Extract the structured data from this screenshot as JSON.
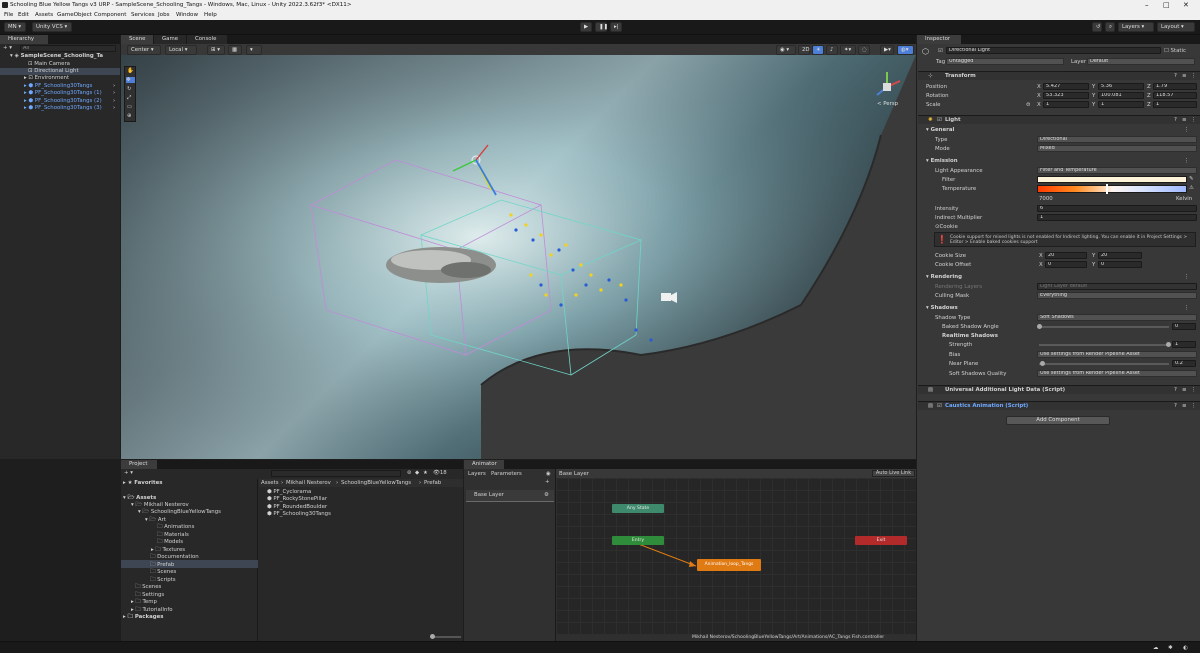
{
  "window": {
    "title": "Schooling Blue Yellow Tangs v3 URP - SampleScene_Schooling_Tangs - Windows, Mac, Linux - Unity 2022.3.62f3* <DX11>",
    "controls": [
      "–",
      "□",
      "✕"
    ]
  },
  "menu": [
    "File",
    "Edit",
    "Assets",
    "GameObject",
    "Component",
    "Services",
    "Jobs",
    "Window",
    "Help"
  ],
  "toolbar": {
    "account": "MN",
    "vcs": "Unity VCS",
    "layers": "Layers",
    "layout": "Layout"
  },
  "hierarchy": {
    "tab": "Hierarchy",
    "search_placeholder": "All",
    "scene": "SampleScene_Schooling_Ta",
    "items": [
      {
        "label": "Main Camera",
        "prefab": false
      },
      {
        "label": "Directional Light",
        "prefab": false,
        "selected": true
      },
      {
        "label": "Environment",
        "prefab": false
      },
      {
        "label": "PF_Schooling30Tangs",
        "prefab": true
      },
      {
        "label": "PF_Schooling30Tangs (1)",
        "prefab": true
      },
      {
        "label": "PF_Schooling30Tangs (2)",
        "prefab": true
      },
      {
        "label": "PF_Schooling30Tangs (3)",
        "prefab": true
      }
    ]
  },
  "scene_view": {
    "tabs": [
      "Scene",
      "Game",
      "Console"
    ],
    "pivot": "Center",
    "space": "Local",
    "mode_2d": "2D",
    "persp": "< Persp"
  },
  "project": {
    "tab": "Project",
    "favorites": "Favorites",
    "tree": [
      {
        "label": "Assets",
        "depth": 0,
        "bold": true
      },
      {
        "label": "Mikhail Nesterov",
        "depth": 1
      },
      {
        "label": "SchoolingBlueYellowTangs",
        "depth": 2
      },
      {
        "label": "Art",
        "depth": 3
      },
      {
        "label": "Animations",
        "depth": 4
      },
      {
        "label": "Materials",
        "depth": 4
      },
      {
        "label": "Models",
        "depth": 4
      },
      {
        "label": "Textures",
        "depth": 4
      },
      {
        "label": "Documentation",
        "depth": 3
      },
      {
        "label": "Prefab",
        "depth": 3,
        "selected": true
      },
      {
        "label": "Scenes",
        "depth": 3
      },
      {
        "label": "Scripts",
        "depth": 3
      },
      {
        "label": "Scenes",
        "depth": 1
      },
      {
        "label": "Settings",
        "depth": 1
      },
      {
        "label": "Temp",
        "depth": 1
      },
      {
        "label": "TutorialInfo",
        "depth": 1
      },
      {
        "label": "Packages",
        "depth": 0,
        "bold": true
      }
    ],
    "breadcrumb": [
      "Assets",
      "Mikhail Nesterov",
      "SchoolingBlueYellowTangs",
      "Prefab"
    ],
    "files": [
      "PF_Cyclorama",
      "PF_RockyStonePillar",
      "PF_RoundedBoulder",
      "PF_Schooling30Tangs"
    ],
    "count": "18"
  },
  "animator": {
    "tab": "Animator",
    "layers_tab": "Layers",
    "params_tab": "Parameters",
    "layer_crumb": "Base Layer",
    "auto_live": "Auto Live Link",
    "base_layer": "Base Layer",
    "states": {
      "any": "Any State",
      "entry": "Entry",
      "exit": "Exit",
      "anim": "Animation_loop_Tangs"
    },
    "path": "Mikhail Nesterov/SchoolingBlueYellowTangs/Art/Animations/AC_Tangs Fish.controller"
  },
  "inspector": {
    "tab": "Inspector",
    "object_name": "Directional Light",
    "static": "Static",
    "tag_label": "Tag",
    "tag": "Untagged",
    "layer_label": "Layer",
    "layer": "Default",
    "transform": {
      "title": "Transform",
      "rows": [
        {
          "label": "Position",
          "x": "5.427",
          "y": "5.36",
          "z": "1.79"
        },
        {
          "label": "Rotation",
          "x": "53.323",
          "y": "100.081",
          "z": "118.57"
        },
        {
          "label": "Scale",
          "x": "1",
          "y": "1",
          "z": "1"
        }
      ]
    },
    "light": {
      "title": "Light",
      "general": "General",
      "type_label": "Type",
      "type": "Directional",
      "mode_label": "Mode",
      "mode": "Mixed",
      "emission": "Emission",
      "appearance_label": "Light Appearance",
      "appearance": "Filter and Temperature",
      "filter_label": "Filter",
      "temperature_label": "Temperature",
      "temperature_value": "7000",
      "kelvin": "Kelvin",
      "intensity_label": "Intensity",
      "intensity": "6",
      "indirect_label": "Indirect Multiplier",
      "indirect": "1",
      "cookie_label": "Cookie",
      "cookie_note": "Cookie support for mixed lights is not enabled for Indirect lighting. You can enable it in Project Settings > Editor > Enable baked cookies support",
      "cookie_size_label": "Cookie Size",
      "cookie_size_x": "20",
      "cookie_size_y": "20",
      "cookie_offset_label": "Cookie Offset",
      "cookie_offset_x": "0",
      "cookie_offset_y": "0",
      "rendering": "Rendering",
      "rendering_layers_label": "Rendering Layers",
      "rendering_layers": "Light Layer default",
      "culling_label": "Culling Mask",
      "culling": "Everything",
      "shadows": "Shadows",
      "shadow_type_label": "Shadow Type",
      "shadow_type": "Soft Shadows",
      "baked_angle_label": "Baked Shadow Angle",
      "baked_angle": "0",
      "realtime_label": "Realtime Shadows",
      "strength_label": "Strength",
      "strength": "1",
      "bias_label": "Bias",
      "bias": "Use settings from Render Pipeline Asset",
      "near_label": "Near Plane",
      "near": "0.2",
      "soft_quality_label": "Soft Shadows Quality",
      "soft_quality": "Use settings from Render Pipeline Asset"
    },
    "ual_title": "Universal Additional Light Data (Script)",
    "caustics_title": "Caustics Animation (Script)",
    "add_component": "Add Component"
  },
  "colors": {
    "accent_blue": "#4d7fd8",
    "prefab_blue": "#6fa8ff",
    "any_state": "#3d8a6d",
    "entry": "#2e8c3a",
    "exit": "#b22a2a",
    "default_state": "#e07a12"
  }
}
